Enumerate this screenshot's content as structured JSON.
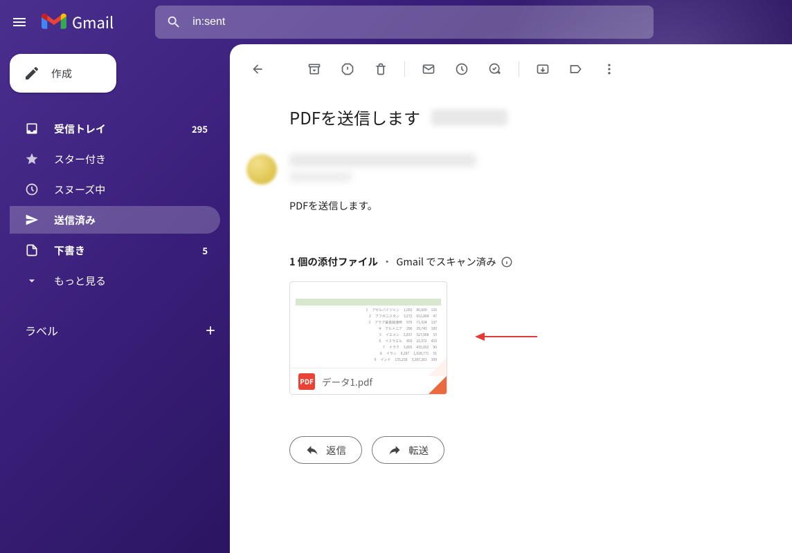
{
  "header": {
    "product": "Gmail",
    "search_value": "in:sent"
  },
  "compose_label": "作成",
  "sidebar": {
    "items": [
      {
        "label": "受信トレイ",
        "count": "295"
      },
      {
        "label": "スター付き"
      },
      {
        "label": "スヌーズ中"
      },
      {
        "label": "送信済み"
      },
      {
        "label": "下書き",
        "count": "5"
      },
      {
        "label": "もっと見る"
      }
    ],
    "labels_header": "ラベル"
  },
  "message": {
    "subject": "PDFを送信します",
    "body": "PDFを送信します。",
    "attachments_header_bold": "1 個の添付ファイル",
    "attachments_header_rest": "Gmail でスキャン済み",
    "attachment_name": "データ1.pdf",
    "pdf_badge": "PDF"
  },
  "actions": {
    "reply": "返信",
    "forward": "転送"
  }
}
